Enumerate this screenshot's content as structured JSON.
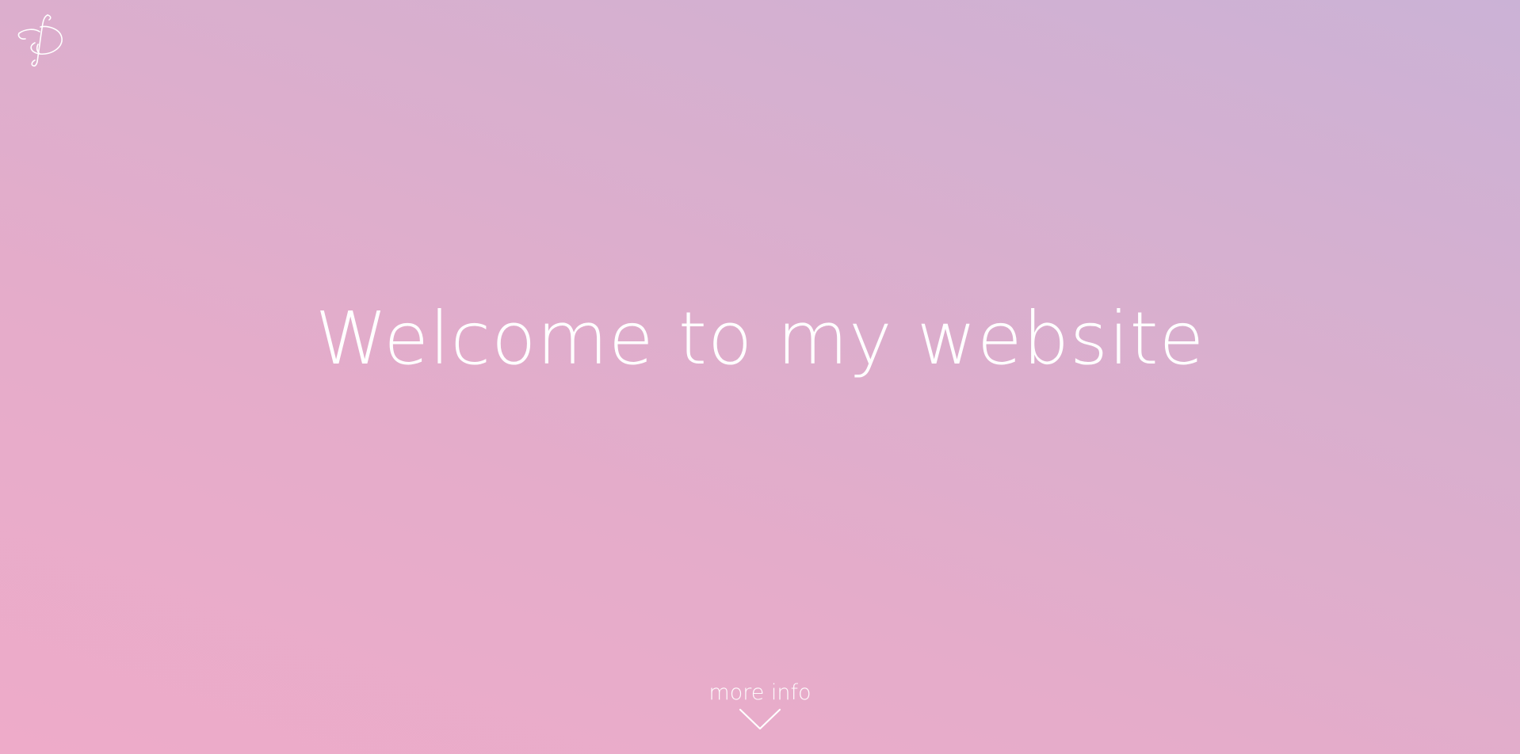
{
  "logo": {
    "icon": "fp-monogram-logo",
    "label": "FP monogram"
  },
  "hero": {
    "title": "Welcome to my website"
  },
  "more_info": {
    "label": "more info",
    "icon": "chevron-down-icon"
  },
  "colors": {
    "gradient_start": "#eeabc9",
    "gradient_end": "#cbb2d6",
    "text": "#ffffff"
  }
}
